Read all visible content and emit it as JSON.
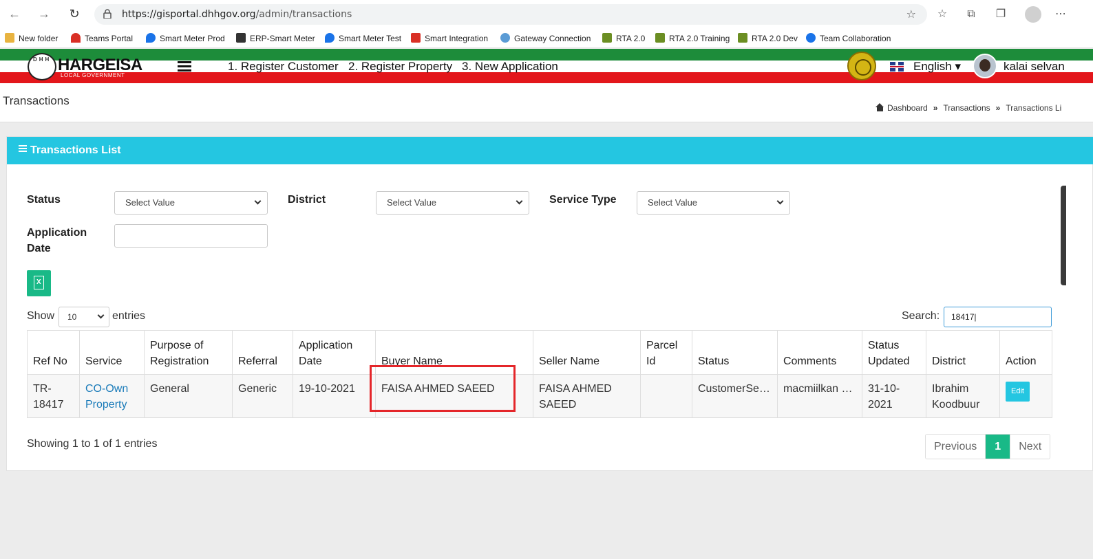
{
  "browser": {
    "url_domain": "https://gisportal.dhhgov.org",
    "url_path": "/admin/transactions",
    "bookmarks": [
      {
        "label": "New folder",
        "color": "#e8b340"
      },
      {
        "label": "Teams Portal",
        "color": "#d93025"
      },
      {
        "label": "Smart Meter Prod",
        "color": "#1a73e8"
      },
      {
        "label": "ERP-Smart Meter",
        "color": "#333333"
      },
      {
        "label": "Smart Meter Test",
        "color": "#1a73e8"
      },
      {
        "label": "Smart Integration",
        "color": "#d93025"
      },
      {
        "label": "Gateway Connection",
        "color": "#5a9bd5"
      },
      {
        "label": "RTA 2.0",
        "color": "#6b8e23"
      },
      {
        "label": "RTA 2.0 Training",
        "color": "#6b8e23"
      },
      {
        "label": "RTA 2.0 Dev",
        "color": "#6b8e23"
      },
      {
        "label": "Team Collaboration",
        "color": "#1a73e8"
      }
    ]
  },
  "header": {
    "logo_title": "HARGEISA",
    "logo_sub": "LOCAL GOVERNMENT",
    "logo_letters": "DHH",
    "links": [
      "1. Register Customer",
      "2. Register Property",
      "3. New Application"
    ],
    "language": "English",
    "user": "kalai selvan"
  },
  "page": {
    "title": "Transactions",
    "breadcrumb": [
      "Dashboard",
      "Transactions",
      "Transactions Li"
    ]
  },
  "card": {
    "title": "Transactions List",
    "filters": {
      "status_label": "Status",
      "district_label": "District",
      "service_type_label": "Service Type",
      "app_date_label_1": "Application",
      "app_date_label_2": "Date",
      "select_placeholder": "Select Value"
    },
    "show_label": "Show",
    "entries_label": "entries",
    "page_length": "10",
    "search_label": "Search:",
    "search_value": "18417|"
  },
  "table": {
    "headers": [
      "Ref No",
      "Service",
      "Purpose of Registration",
      "Referral",
      "Application Date",
      "Buyer Name",
      "Seller Name",
      "Parcel Id",
      "Status",
      "Comments",
      "Status Updated",
      "District",
      "Action"
    ],
    "rows": [
      {
        "ref_no": "TR-18417",
        "service": "CO-Own Property",
        "purpose": "General",
        "referral": "Generic",
        "application_date": "19-10-2021",
        "buyer_name": "FAISA AHMED SAEED",
        "seller_name": "FAISA AHMED SAEED",
        "parcel_id": "",
        "status": "CustomerService",
        "comments": "macmiilkan n...",
        "status_updated": "31-10-2021",
        "district": "Ibrahim Koodbuur",
        "action": "Edit"
      }
    ]
  },
  "footer": {
    "showing": "Showing 1 to 1 of 1 entries",
    "prev": "Previous",
    "page": "1",
    "next": "Next"
  },
  "colors": {
    "accent": "#24c6e1",
    "success": "#19b987",
    "highlight": "#e4262a",
    "stripe_green": "#1d8c3a",
    "stripe_red": "#e3161b"
  }
}
